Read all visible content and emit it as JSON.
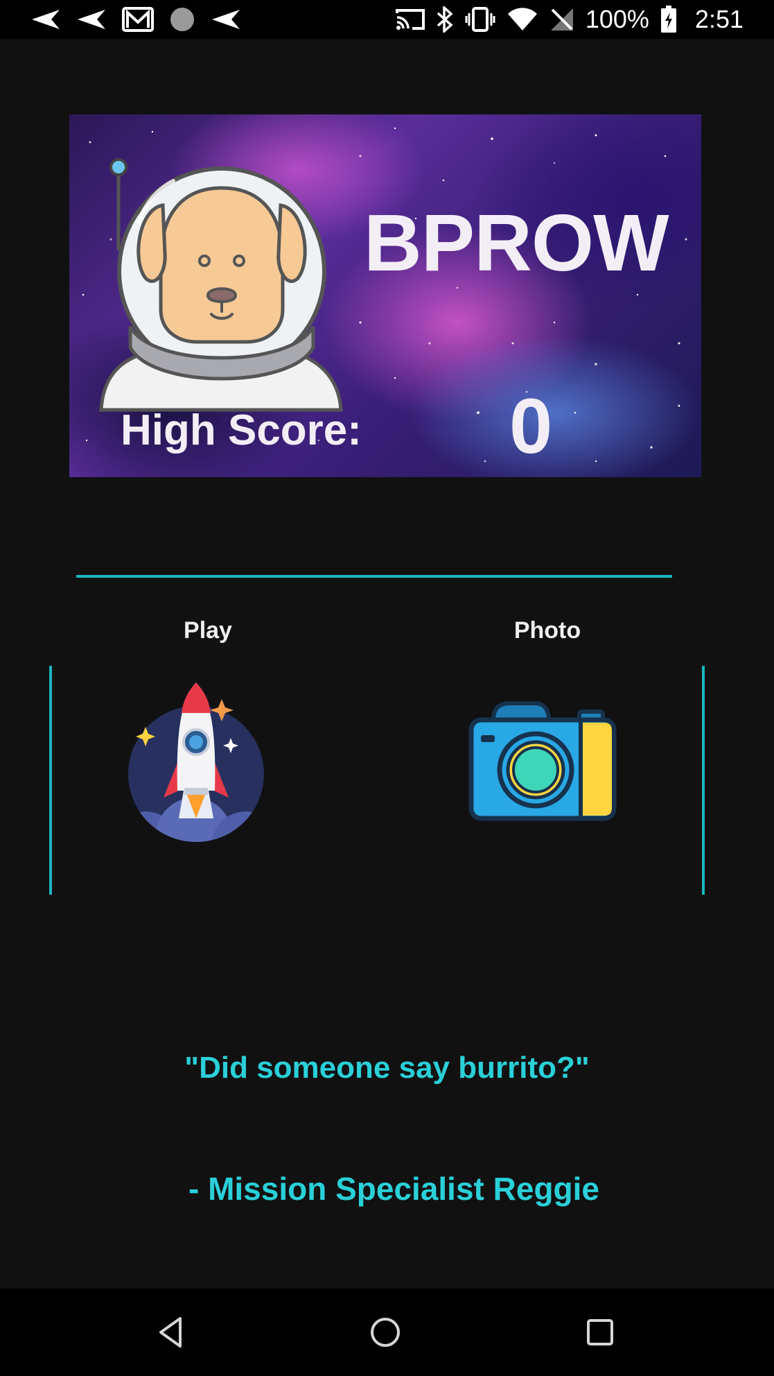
{
  "status_bar": {
    "battery_text": "100%",
    "clock": "2:51",
    "left_icons": [
      "send-icon",
      "send-icon",
      "gmail-icon",
      "dot-icon",
      "send-icon"
    ],
    "right_icons": [
      "cast-icon",
      "bluetooth-icon",
      "vibrate-icon",
      "wifi-icon",
      "no-signal-icon",
      "battery-icon"
    ]
  },
  "profile": {
    "username": "BPROW",
    "high_score_label": "High Score:",
    "high_score_value": "0",
    "avatar": "astronaut-dog-avatar"
  },
  "actions": [
    {
      "label": "Play",
      "icon": "rocket-icon"
    },
    {
      "label": "Photo",
      "icon": "camera-icon"
    }
  ],
  "quote": {
    "text": "\"Did someone say burrito?\"",
    "author": "- Mission Specialist Reggie"
  },
  "nav_bar": {
    "buttons": [
      "back-icon",
      "home-icon",
      "recents-icon"
    ]
  },
  "colors": {
    "accent": "#1ab5bf",
    "quote_text": "#2ad0d8",
    "background": "#111112"
  }
}
